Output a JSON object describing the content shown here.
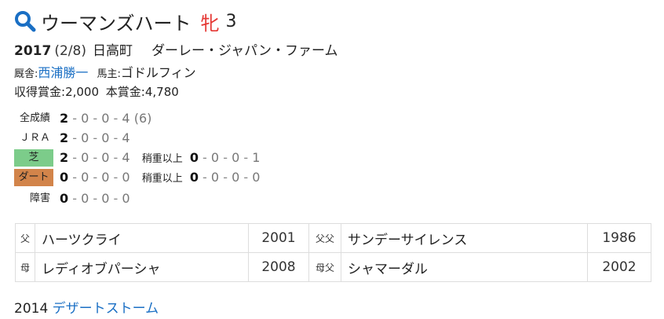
{
  "horse": {
    "name": "ウーマンズハート",
    "sex": "牝",
    "age": "3",
    "birth_year": "2017",
    "birth_date": "(2/8)",
    "birthplace": "日高町",
    "breeder": "ダーレー・ジャパン・ファーム"
  },
  "people": {
    "trainer_label": "厩舎:",
    "trainer": "西浦勝一",
    "owner_label": "馬主:",
    "owner": "ゴドルフィン"
  },
  "money": {
    "earned_label": "収得賞金:",
    "earned": "2,000",
    "prize_label": "本賞金:",
    "prize": "4,780"
  },
  "records": {
    "all": {
      "label": "全成績",
      "w": "2",
      "p2": "0",
      "p3": "0",
      "o": "4",
      "extra": "(6)"
    },
    "jra": {
      "label": "ＪＲＡ",
      "w": "2",
      "p2": "0",
      "p3": "0",
      "o": "4"
    },
    "turf": {
      "label": "芝",
      "w": "2",
      "p2": "0",
      "p3": "0",
      "o": "4",
      "sub_label": "稍重以上",
      "sw": "0",
      "sp2": "0",
      "sp3": "0",
      "so": "1"
    },
    "dirt": {
      "label": "ダート",
      "w": "0",
      "p2": "0",
      "p3": "0",
      "o": "0",
      "sub_label": "稍重以上",
      "sw": "0",
      "sp2": "0",
      "sp3": "0",
      "so": "0"
    },
    "hurdle": {
      "label": "障害",
      "w": "0",
      "p2": "0",
      "p3": "0",
      "o": "0"
    },
    "dash": "-"
  },
  "pedigree": {
    "sire_label": "父",
    "sire": "ハーツクライ",
    "sire_year": "2001",
    "sire_sire_label": "父父",
    "sire_sire": "サンデーサイレンス",
    "sire_sire_year": "1986",
    "dam_label": "母",
    "dam": "レディオブパーシャ",
    "dam_year": "2008",
    "dam_sire_label": "母父",
    "dam_sire": "シャマーダル",
    "dam_sire_year": "2002"
  },
  "offspring": {
    "year": "2014",
    "name": "デザートストーム"
  },
  "colors": {
    "accent": "#1a6fc4",
    "sex_female": "#e53935",
    "turf": "#7ccc8a",
    "dirt": "#d2844a"
  }
}
